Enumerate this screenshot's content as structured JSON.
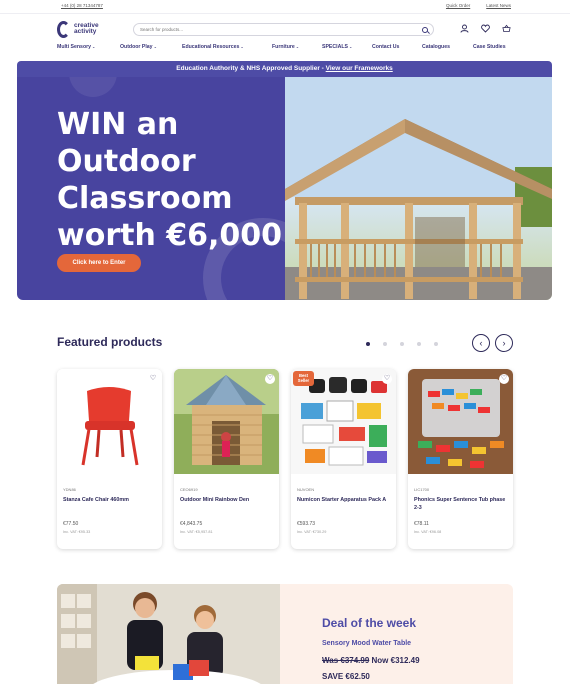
{
  "topbar": {
    "phone": "+44 (0) 28 71344787",
    "quick_order": "Quick Order",
    "latest_news": "Latest News"
  },
  "logo": {
    "line1": "creative",
    "line2": "activity"
  },
  "search": {
    "placeholder": "Search for products..."
  },
  "header_icons": [
    "user-icon",
    "heart-icon",
    "basket-icon"
  ],
  "nav": [
    {
      "label": "Multi Sensory",
      "dropdown": true
    },
    {
      "label": "Outdoor Play",
      "dropdown": true
    },
    {
      "label": "Educational Resources",
      "dropdown": true
    },
    {
      "label": "Furniture",
      "dropdown": true
    },
    {
      "label": "SPECIALS",
      "dropdown": true
    },
    {
      "label": "Contact Us",
      "dropdown": false
    },
    {
      "label": "Catalogues",
      "dropdown": false
    },
    {
      "label": "Case Studies",
      "dropdown": false
    }
  ],
  "banner": {
    "strip_text": "Education Authority & NHS Approved Supplier - ",
    "strip_link": "View our Frameworks",
    "title_lines": [
      "WIN an",
      "Outdoor",
      "Classroom",
      "worth €6,000"
    ],
    "cta": "Click here to Enter"
  },
  "featured": {
    "title": "Featured products",
    "dot_count": 5,
    "active_dot": 0,
    "products": [
      {
        "code": "YDN86",
        "name": "Stanza Cafe Chair 460mm",
        "price": "€77.50",
        "vat": "Inc. VAT: €95.33",
        "badge": ""
      },
      {
        "code": "CEO6919",
        "name": "Outdoor Mini Rainbow Den",
        "price": "€4,843.75",
        "vat": "Inc. VAT: €5,957.81",
        "badge": ""
      },
      {
        "code": "NUVOEN",
        "name": "Numicon Starter Apparatus Pack A",
        "price": "€593.73",
        "vat": "Inc. VAT: €730.29",
        "badge": "Best Seller"
      },
      {
        "code": "LIC1700",
        "name": "Phonics Super Sentence Tub phase 2-3",
        "price": "€78.11",
        "vat": "Inc. VAT: €96.08",
        "badge": ""
      }
    ]
  },
  "deal": {
    "title": "Deal of the week",
    "product": "Sensory Mood Water Table",
    "old_price": "Was €374.99",
    "new_price": " Now €312.49",
    "save": "SAVE €62.50"
  },
  "colors": {
    "brand": "#3b3779",
    "banner": "#48449f",
    "accent": "#e4673a",
    "deal_bg": "#fdf0e9"
  }
}
